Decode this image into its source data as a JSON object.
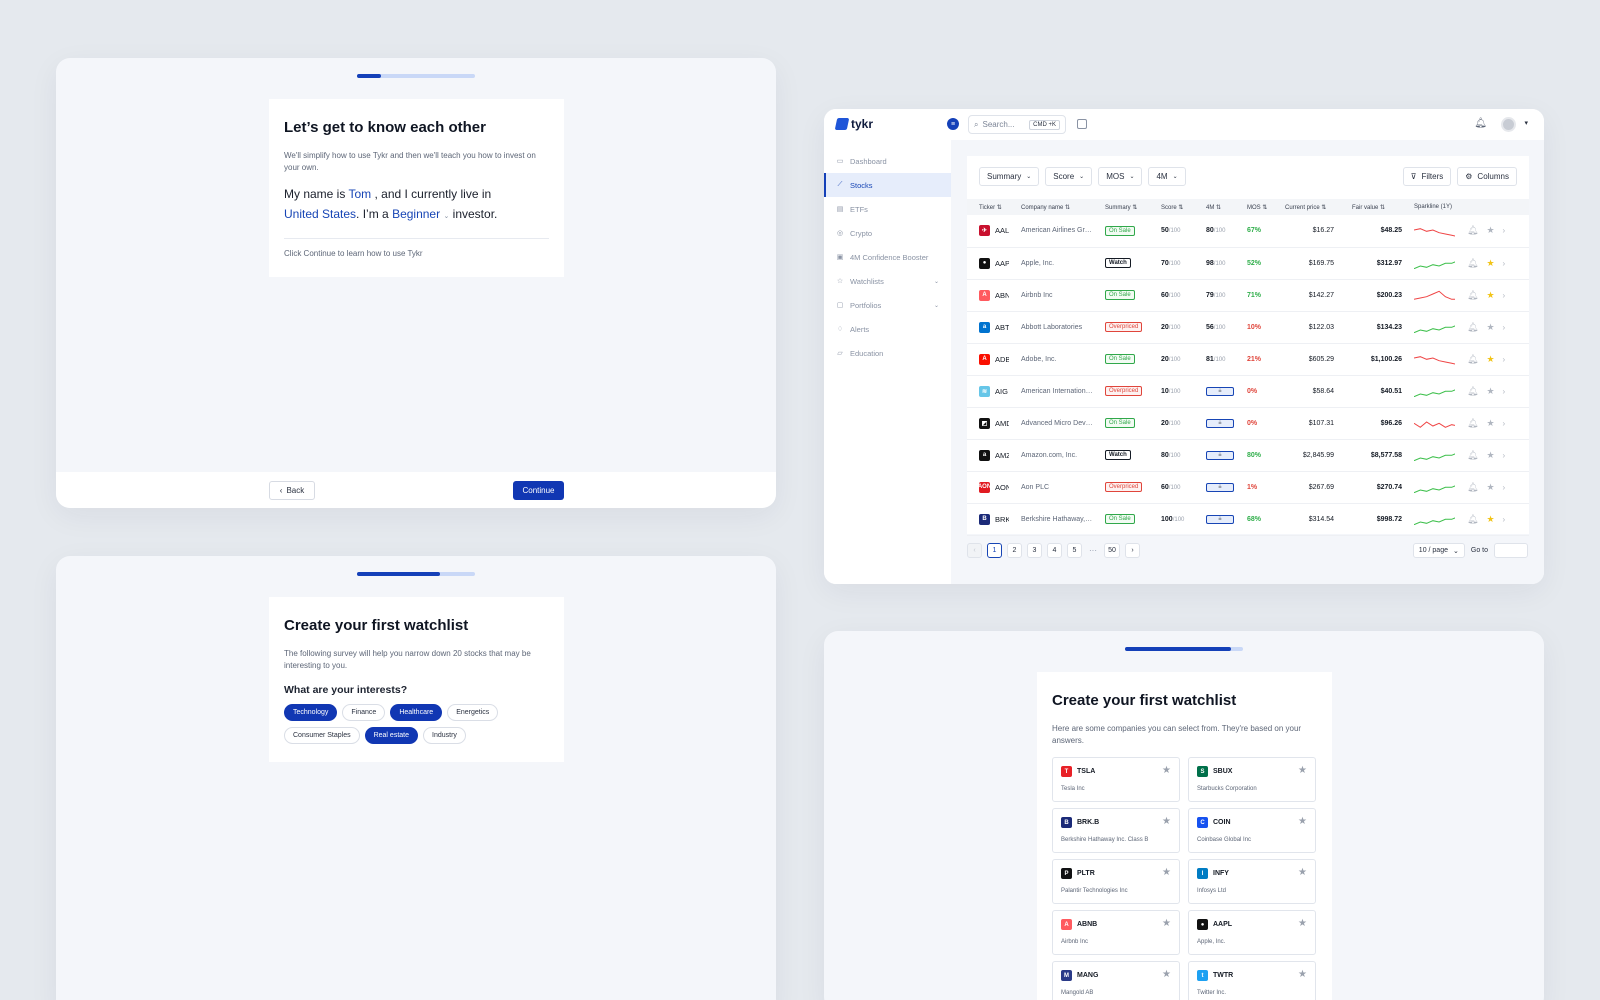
{
  "onboarding_intro": {
    "progress": 0.2,
    "title": "Let’s get to know each other",
    "description": "We'll simplify how to use Tykr and then we'll teach you how to invest on your own.",
    "sentence": {
      "p1": "My name is ",
      "name": "Tom",
      "p2": " , and I currently live in",
      "country": "United States",
      "p3": ". I’m a ",
      "level": "Beginner",
      "p4": " investor."
    },
    "hint": "Click Continue to learn how to use Tykr",
    "back_label": "Back",
    "continue_label": "Continue"
  },
  "onboarding_interests": {
    "progress": 0.7,
    "title": "Create your first watchlist",
    "description": "The following survey will help you narrow down 20 stocks that may be interesting to you.",
    "question": "What are your interests?",
    "chips": [
      {
        "label": "Technology",
        "selected": true
      },
      {
        "label": "Finance",
        "selected": false
      },
      {
        "label": "Healthcare",
        "selected": true
      },
      {
        "label": "Energetics",
        "selected": false
      },
      {
        "label": "Consumer Staples",
        "selected": false
      },
      {
        "label": "Real estate",
        "selected": true
      },
      {
        "label": "Industry",
        "selected": false
      }
    ]
  },
  "onboarding_watchlist": {
    "progress": 0.9,
    "title": "Create your first watchlist",
    "description": "Here are some companies you can select from. They're based on your answers.",
    "companies": [
      {
        "ticker": "TSLA",
        "name": "Tesla Inc",
        "logo": "T",
        "color": "#e82127"
      },
      {
        "ticker": "SBUX",
        "name": "Starbucks Corporation",
        "logo": "S",
        "color": "#00704a"
      },
      {
        "ticker": "BRK.B",
        "name": "Berkshire Hathaway Inc. Class B",
        "logo": "B",
        "color": "#1b2a78"
      },
      {
        "ticker": "COIN",
        "name": "Coinbase Global Inc",
        "logo": "C",
        "color": "#1652f0"
      },
      {
        "ticker": "PLTR",
        "name": "Palantir Technologies Inc",
        "logo": "P",
        "color": "#101113"
      },
      {
        "ticker": "INFY",
        "name": "Infosys Ltd",
        "logo": "I",
        "color": "#007cc3"
      },
      {
        "ticker": "ABNB",
        "name": "Airbnb Inc",
        "logo": "A",
        "color": "#ff5a5f"
      },
      {
        "ticker": "AAPL",
        "name": "Apple, Inc.",
        "logo": "",
        "color": "#111111"
      },
      {
        "ticker": "MANG",
        "name": "Mangold AB",
        "logo": "M",
        "color": "#2a3a88"
      },
      {
        "ticker": "TWTR",
        "name": "Twitter Inc.",
        "logo": "t",
        "color": "#1da1f2"
      }
    ]
  },
  "app": {
    "brand": "tykr",
    "search_placeholder": "Search...",
    "search_shortcut": "CMD +K",
    "nav": [
      {
        "label": "Dashboard",
        "icon": "dashboard-icon",
        "glyph": "▭",
        "active": false,
        "caret": false
      },
      {
        "label": "Stocks",
        "icon": "chart-line-icon",
        "glyph": "⟋",
        "active": true,
        "caret": false
      },
      {
        "label": "ETFs",
        "icon": "document-icon",
        "glyph": "▤",
        "active": false,
        "caret": false
      },
      {
        "label": "Crypto",
        "icon": "coin-icon",
        "glyph": "◎",
        "active": false,
        "caret": false
      },
      {
        "label": "4M Confidence Booster",
        "icon": "booster-icon",
        "glyph": "▣",
        "active": false,
        "caret": false
      },
      {
        "label": "Watchlists",
        "icon": "star-icon",
        "glyph": "☆",
        "active": false,
        "caret": true
      },
      {
        "label": "Portfolios",
        "icon": "portfolio-icon",
        "glyph": "▢",
        "active": false,
        "caret": true
      },
      {
        "label": "Alerts",
        "icon": "bell-icon",
        "glyph": "♢",
        "active": false,
        "caret": false
      },
      {
        "label": "Education",
        "icon": "book-icon",
        "glyph": "▱",
        "active": false,
        "caret": false
      }
    ],
    "filters": [
      "Summary",
      "Score",
      "MOS",
      "4M"
    ],
    "filters_button": "Filters",
    "columns_button": "Columns",
    "table_headers": [
      "Ticker",
      "Company name",
      "Summary",
      "Score",
      "4M",
      "MOS",
      "Current price",
      "Fair value",
      "Sparkline (1Y)"
    ],
    "rows": [
      {
        "ticker": "AAL",
        "company": "American Airlines Group Inc",
        "summary": "On Sale",
        "score": "50",
        "fourm": "80",
        "mos": "67%",
        "price": "$16.27",
        "fair": "$48.25",
        "trend": "down",
        "starred": false,
        "logo": "✈",
        "color": "#c8102e"
      },
      {
        "ticker": "AAPL",
        "company": "Apple, Inc.",
        "summary": "Watch",
        "score": "70",
        "fourm": "98",
        "mos": "52%",
        "price": "$169.75",
        "fair": "$312.97",
        "trend": "up",
        "starred": true,
        "logo": "",
        "color": "#111111"
      },
      {
        "ticker": "ABNB",
        "company": "Airbnb Inc",
        "summary": "On Sale",
        "score": "60",
        "fourm": "79",
        "mos": "71%",
        "price": "$142.27",
        "fair": "$200.23",
        "trend": "peak",
        "starred": true,
        "logo": "A",
        "color": "#ff5a5f"
      },
      {
        "ticker": "ABT",
        "company": "Abbott Laboratories",
        "summary": "Overpriced",
        "score": "20",
        "fourm": "56",
        "mos": "10%",
        "price": "$122.03",
        "fair": "$134.23",
        "trend": "up",
        "starred": false,
        "logo": "a",
        "color": "#0073cf"
      },
      {
        "ticker": "ADBE",
        "company": "Adobe, Inc.",
        "summary": "On Sale",
        "score": "20",
        "fourm": "81",
        "mos": "21%",
        "price": "$605.29",
        "fair": "$1,100.26",
        "trend": "down",
        "starred": true,
        "logo": "A",
        "color": "#fa0f00"
      },
      {
        "ticker": "AIG",
        "company": "American International Gro...",
        "summary": "Overpriced",
        "score": "10",
        "fourm": "",
        "mos": "0%",
        "price": "$58.64",
        "fair": "$40.51",
        "trend": "up",
        "starred": false,
        "logo": "≋",
        "color": "#66c6e8"
      },
      {
        "ticker": "AMD",
        "company": "Advanced Micro Devices...",
        "summary": "On Sale",
        "score": "20",
        "fourm": "",
        "mos": "0%",
        "price": "$107.31",
        "fair": "$96.26",
        "trend": "zigzag",
        "starred": false,
        "logo": "◩",
        "color": "#111111"
      },
      {
        "ticker": "AMZN",
        "company": "Amazon.com, Inc.",
        "summary": "Watch",
        "score": "80",
        "fourm": "",
        "mos": "80%",
        "price": "$2,845.99",
        "fair": "$8,577.58",
        "trend": "up",
        "starred": false,
        "logo": "a",
        "color": "#111111"
      },
      {
        "ticker": "AON",
        "company": "Aon PLC",
        "summary": "Overpriced",
        "score": "60",
        "fourm": "",
        "mos": "1%",
        "price": "$267.69",
        "fair": "$270.74",
        "trend": "up",
        "starred": false,
        "logo": "AON",
        "color": "#e11b22"
      },
      {
        "ticker": "BRK.B",
        "company": "Berkshire Hathaway, Inc. ...",
        "summary": "On Sale",
        "score": "100",
        "fourm": "",
        "mos": "68%",
        "price": "$314.54",
        "fair": "$998.72",
        "trend": "up",
        "starred": true,
        "logo": "B",
        "color": "#1b2a78"
      }
    ],
    "score_suffix": "/100",
    "pagination": {
      "pages": [
        "1",
        "2",
        "3",
        "4",
        "5"
      ],
      "ellipsis": "···",
      "last": "50",
      "current": "1"
    },
    "page_size": "10 / page",
    "goto_label": "Go to"
  }
}
